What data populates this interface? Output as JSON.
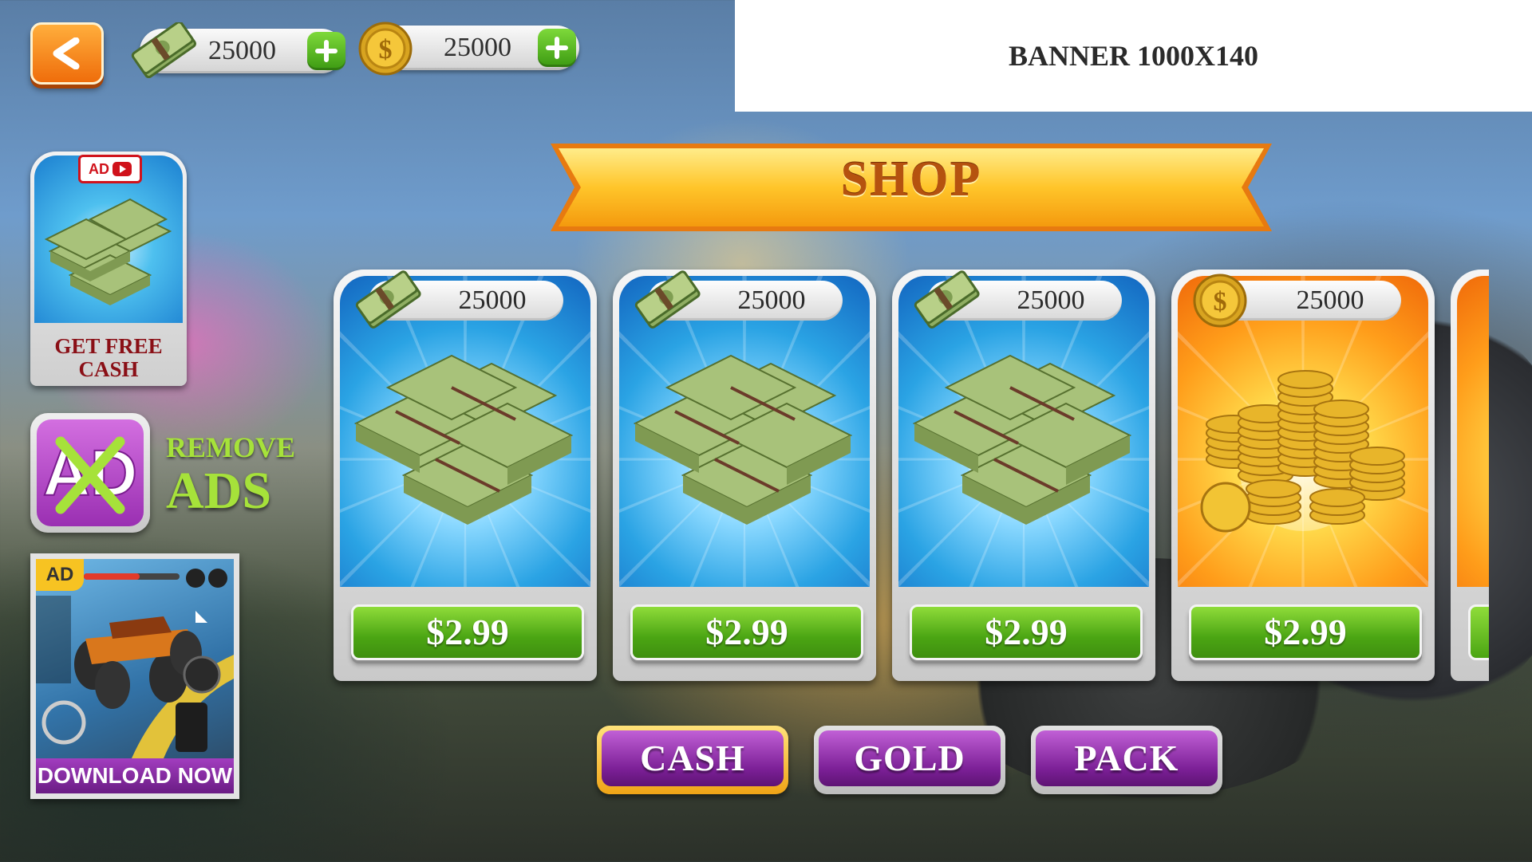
{
  "header": {
    "back_icon": "back-arrow-icon",
    "cash_balance": "25000",
    "gold_balance": "25000",
    "cash_icon": "cash-stack-icon",
    "gold_icon": "gold-coin-icon",
    "plus_icon": "plus-icon"
  },
  "banner": {
    "text": "BANNER 1000X140"
  },
  "shop": {
    "title": "SHOP"
  },
  "sidebar": {
    "free_cash": {
      "ad_label": "AD",
      "label_line1": "GET FREE",
      "label_line2": "CASH"
    },
    "remove_ads": {
      "icon_text": "AD",
      "line1": "REMOVE",
      "line2": "ADS"
    },
    "promo": {
      "ad_label": "AD",
      "cta": "DOWNLOAD NOW"
    }
  },
  "items": [
    {
      "type": "cash",
      "amount": "25000",
      "price": "$2.99"
    },
    {
      "type": "cash",
      "amount": "25000",
      "price": "$2.99"
    },
    {
      "type": "cash",
      "amount": "25000",
      "price": "$2.99"
    },
    {
      "type": "gold",
      "amount": "25000",
      "price": "$2.99"
    }
  ],
  "tabs": [
    {
      "label": "CASH",
      "active": true
    },
    {
      "label": "GOLD",
      "active": false
    },
    {
      "label": "PACK",
      "active": false
    }
  ],
  "colors": {
    "accent_orange": "#ef6d0b",
    "price_green": "#4ba513",
    "tab_purple": "#7b1f96",
    "title_brown": "#b5520f"
  }
}
